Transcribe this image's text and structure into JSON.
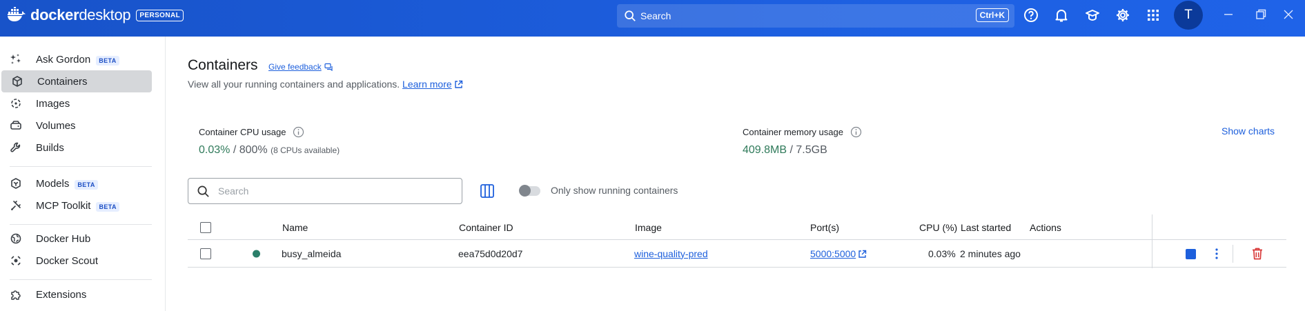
{
  "app": {
    "brand_name": "docker desktop",
    "brand_bold": "docker",
    "brand_light": "desktop",
    "plan_badge": "PERSONAL",
    "search_label": "Search",
    "search_shortcut": "Ctrl+K",
    "avatar_initial": "T",
    "accent_color": "#1d5fdc",
    "topbar_color": "#1d63ed"
  },
  "sidebar": {
    "items": [
      {
        "label": "Ask Gordon",
        "badge": "BETA",
        "icon": "gordon-sparkle-icon"
      },
      {
        "label": "Containers",
        "badge": "",
        "icon": "container-cube-icon",
        "active": true
      },
      {
        "label": "Images",
        "badge": "",
        "icon": "images-icon"
      },
      {
        "label": "Volumes",
        "badge": "",
        "icon": "volumes-drive-icon"
      },
      {
        "label": "Builds",
        "badge": "",
        "icon": "builds-wrench-icon"
      },
      {
        "label": "Models",
        "badge": "BETA",
        "icon": "models-cube-icon"
      },
      {
        "label": "MCP Toolkit",
        "badge": "BETA",
        "icon": "mcp-toolkit-icon"
      },
      {
        "label": "Docker Hub",
        "badge": "",
        "icon": "hub-globe-icon"
      },
      {
        "label": "Docker Scout",
        "badge": "",
        "icon": "scout-target-icon"
      },
      {
        "label": "Extensions",
        "badge": "",
        "icon": "extensions-puzzle-icon"
      }
    ]
  },
  "main": {
    "title": "Containers",
    "feedback_label": "Give feedback",
    "subtitle": "View all your running containers and applications.",
    "learn_more": "Learn more",
    "cpu": {
      "label": "Container CPU usage",
      "value": "0.03%",
      "separator": " / ",
      "total": "800%",
      "note": "(8 CPUs available)"
    },
    "memory": {
      "label": "Container memory usage",
      "value": "409.8MB",
      "separator": " / ",
      "total": "7.5GB"
    },
    "show_charts": "Show charts",
    "search_placeholder": "Search",
    "running_toggle_label": "Only show running containers",
    "running_toggle_on": false
  },
  "table": {
    "columns": [
      "Name",
      "Container ID",
      "Image",
      "Port(s)",
      "CPU (%)",
      "Last started",
      "Actions"
    ],
    "rows": [
      {
        "status": "running",
        "name": "busy_almeida",
        "container_id": "eea75d0d20d7",
        "image": "wine-quality-pred",
        "ports": "5000:5000",
        "cpu": "0.03%",
        "last_started": "2 minutes ago"
      }
    ]
  }
}
